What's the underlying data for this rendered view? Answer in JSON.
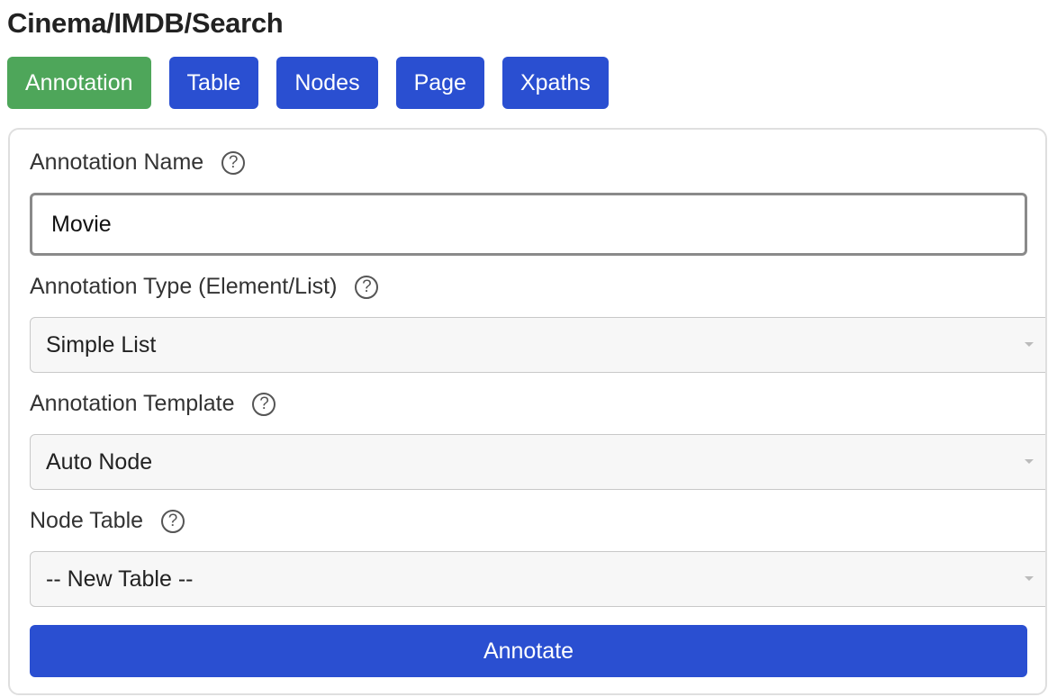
{
  "header": {
    "title": "Cinema/IMDB/Search"
  },
  "tabs": [
    {
      "label": "Annotation",
      "active": true
    },
    {
      "label": "Table",
      "active": false
    },
    {
      "label": "Nodes",
      "active": false
    },
    {
      "label": "Page",
      "active": false
    },
    {
      "label": "Xpaths",
      "active": false
    }
  ],
  "form": {
    "name_label": "Annotation Name",
    "name_value": "Movie",
    "type_label": "Annotation Type (Element/List)",
    "type_value": "Simple List",
    "template_label": "Annotation Template",
    "template_value": "Auto Node",
    "table_label": "Node Table",
    "table_value": "-- New Table --",
    "help_glyph": "?",
    "submit_label": "Annotate"
  },
  "colors": {
    "active_tab": "#4ea65a",
    "primary": "#2a4fd1"
  },
  "icons": {
    "help": "question-circle-icon",
    "dropdown": "chevron-down-icon"
  }
}
